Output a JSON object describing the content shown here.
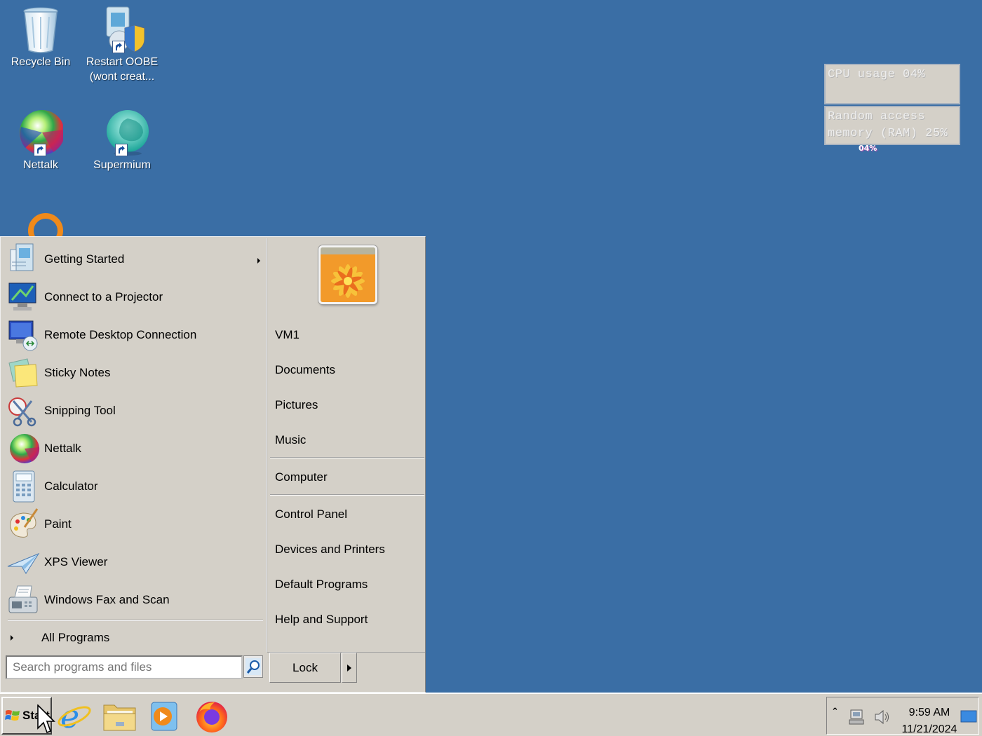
{
  "desktop": {
    "icons": [
      {
        "label": "Recycle Bin"
      },
      {
        "label": "Restart OOBE (wont creat..."
      },
      {
        "label": "Nettalk"
      },
      {
        "label": "Supermium"
      }
    ]
  },
  "gadgets": {
    "cpu_text": "CPU usage 04%",
    "ram_text_line1": "Random access",
    "ram_text_line2": "memory (RAM) 25%",
    "cpu_sub": "04%"
  },
  "start_menu": {
    "programs": [
      {
        "label": "Getting Started",
        "icon": "getting-started-icon",
        "has_submenu": true
      },
      {
        "label": "Connect to a Projector",
        "icon": "projector-icon"
      },
      {
        "label": "Remote Desktop Connection",
        "icon": "remote-desktop-icon"
      },
      {
        "label": "Sticky Notes",
        "icon": "sticky-notes-icon"
      },
      {
        "label": "Snipping Tool",
        "icon": "scissors-icon"
      },
      {
        "label": "Nettalk",
        "icon": "nettalk-icon"
      },
      {
        "label": "Calculator",
        "icon": "calculator-icon"
      },
      {
        "label": "Paint",
        "icon": "paint-palette-icon"
      },
      {
        "label": "XPS Viewer",
        "icon": "paper-plane-icon"
      },
      {
        "label": "Windows Fax and Scan",
        "icon": "fax-icon"
      }
    ],
    "all_programs": "All Programs",
    "search_placeholder": "Search programs and files",
    "right_items": {
      "user": "VM1",
      "documents": "Documents",
      "pictures": "Pictures",
      "music": "Music",
      "computer": "Computer",
      "control_panel": "Control Panel",
      "devices": "Devices and Printers",
      "default_programs": "Default Programs",
      "help": "Help and Support"
    },
    "lock_label": "Lock"
  },
  "taskbar": {
    "start_label": "Start",
    "pinned": [
      "internet-explorer-icon",
      "file-explorer-icon",
      "media-player-icon",
      "firefox-icon"
    ],
    "time": "9:59 AM",
    "date": "11/21/2024"
  }
}
